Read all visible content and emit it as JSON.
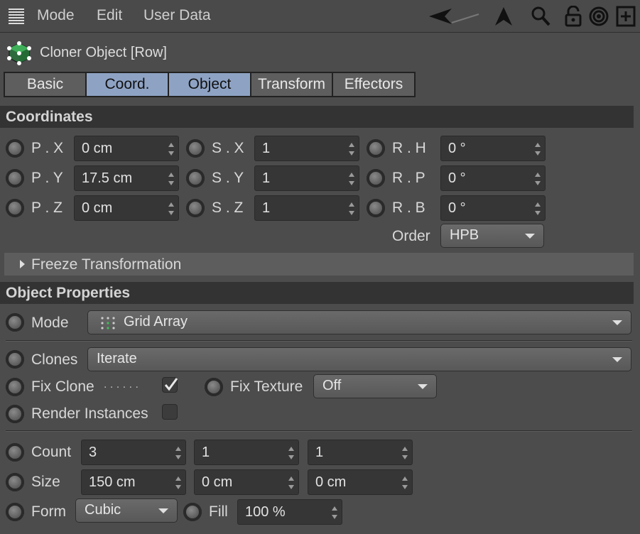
{
  "menubar": {
    "items": [
      "Mode",
      "Edit",
      "User Data"
    ],
    "icons": [
      "grid-icon",
      "back-arrow-icon",
      "up-arrow-icon",
      "search-icon",
      "lock-icon",
      "target-icon",
      "new-window-icon"
    ]
  },
  "object": {
    "title": "Cloner Object [Row]"
  },
  "tabs": [
    {
      "label": "Basic",
      "active": false
    },
    {
      "label": "Coord.",
      "active": true
    },
    {
      "label": "Object",
      "active": true
    },
    {
      "label": "Transform",
      "active": false
    },
    {
      "label": "Effectors",
      "active": false
    }
  ],
  "coordinates": {
    "header": "Coordinates",
    "position": [
      {
        "label": "P . X",
        "value": "0 cm"
      },
      {
        "label": "P . Y",
        "value": "17.5 cm"
      },
      {
        "label": "P . Z",
        "value": "0 cm"
      }
    ],
    "scale": [
      {
        "label": "S . X",
        "value": "1"
      },
      {
        "label": "S . Y",
        "value": "1"
      },
      {
        "label": "S . Z",
        "value": "1"
      }
    ],
    "rotation": [
      {
        "label": "R . H",
        "value": "0 °"
      },
      {
        "label": "R . P",
        "value": "0 °"
      },
      {
        "label": "R . B",
        "value": "0 °"
      }
    ],
    "order_label": "Order",
    "order_value": "HPB",
    "freeze_label": "Freeze Transformation"
  },
  "object_properties": {
    "header": "Object Properties",
    "mode_label": "Mode",
    "mode_value": "Grid Array",
    "clones_label": "Clones",
    "clones_value": "Iterate",
    "fix_clone_label": "Fix Clone",
    "fix_clone_dots": ". . . . . .",
    "fix_clone_checked": true,
    "fix_texture_label": "Fix Texture",
    "fix_texture_value": "Off",
    "render_instances_label": "Render Instances",
    "render_instances_checked": false,
    "count_label": "Count",
    "count_values": [
      "3",
      "1",
      "1"
    ],
    "size_label": "Size",
    "size_values": [
      "150 cm",
      "0 cm",
      "0 cm"
    ],
    "form_label": "Form",
    "form_value": "Cubic",
    "fill_label": "Fill",
    "fill_value": "100 %"
  },
  "colors": {
    "accent_tab": "#8ea3c4",
    "background": "#4c4c4c",
    "section_header": "#333333"
  }
}
